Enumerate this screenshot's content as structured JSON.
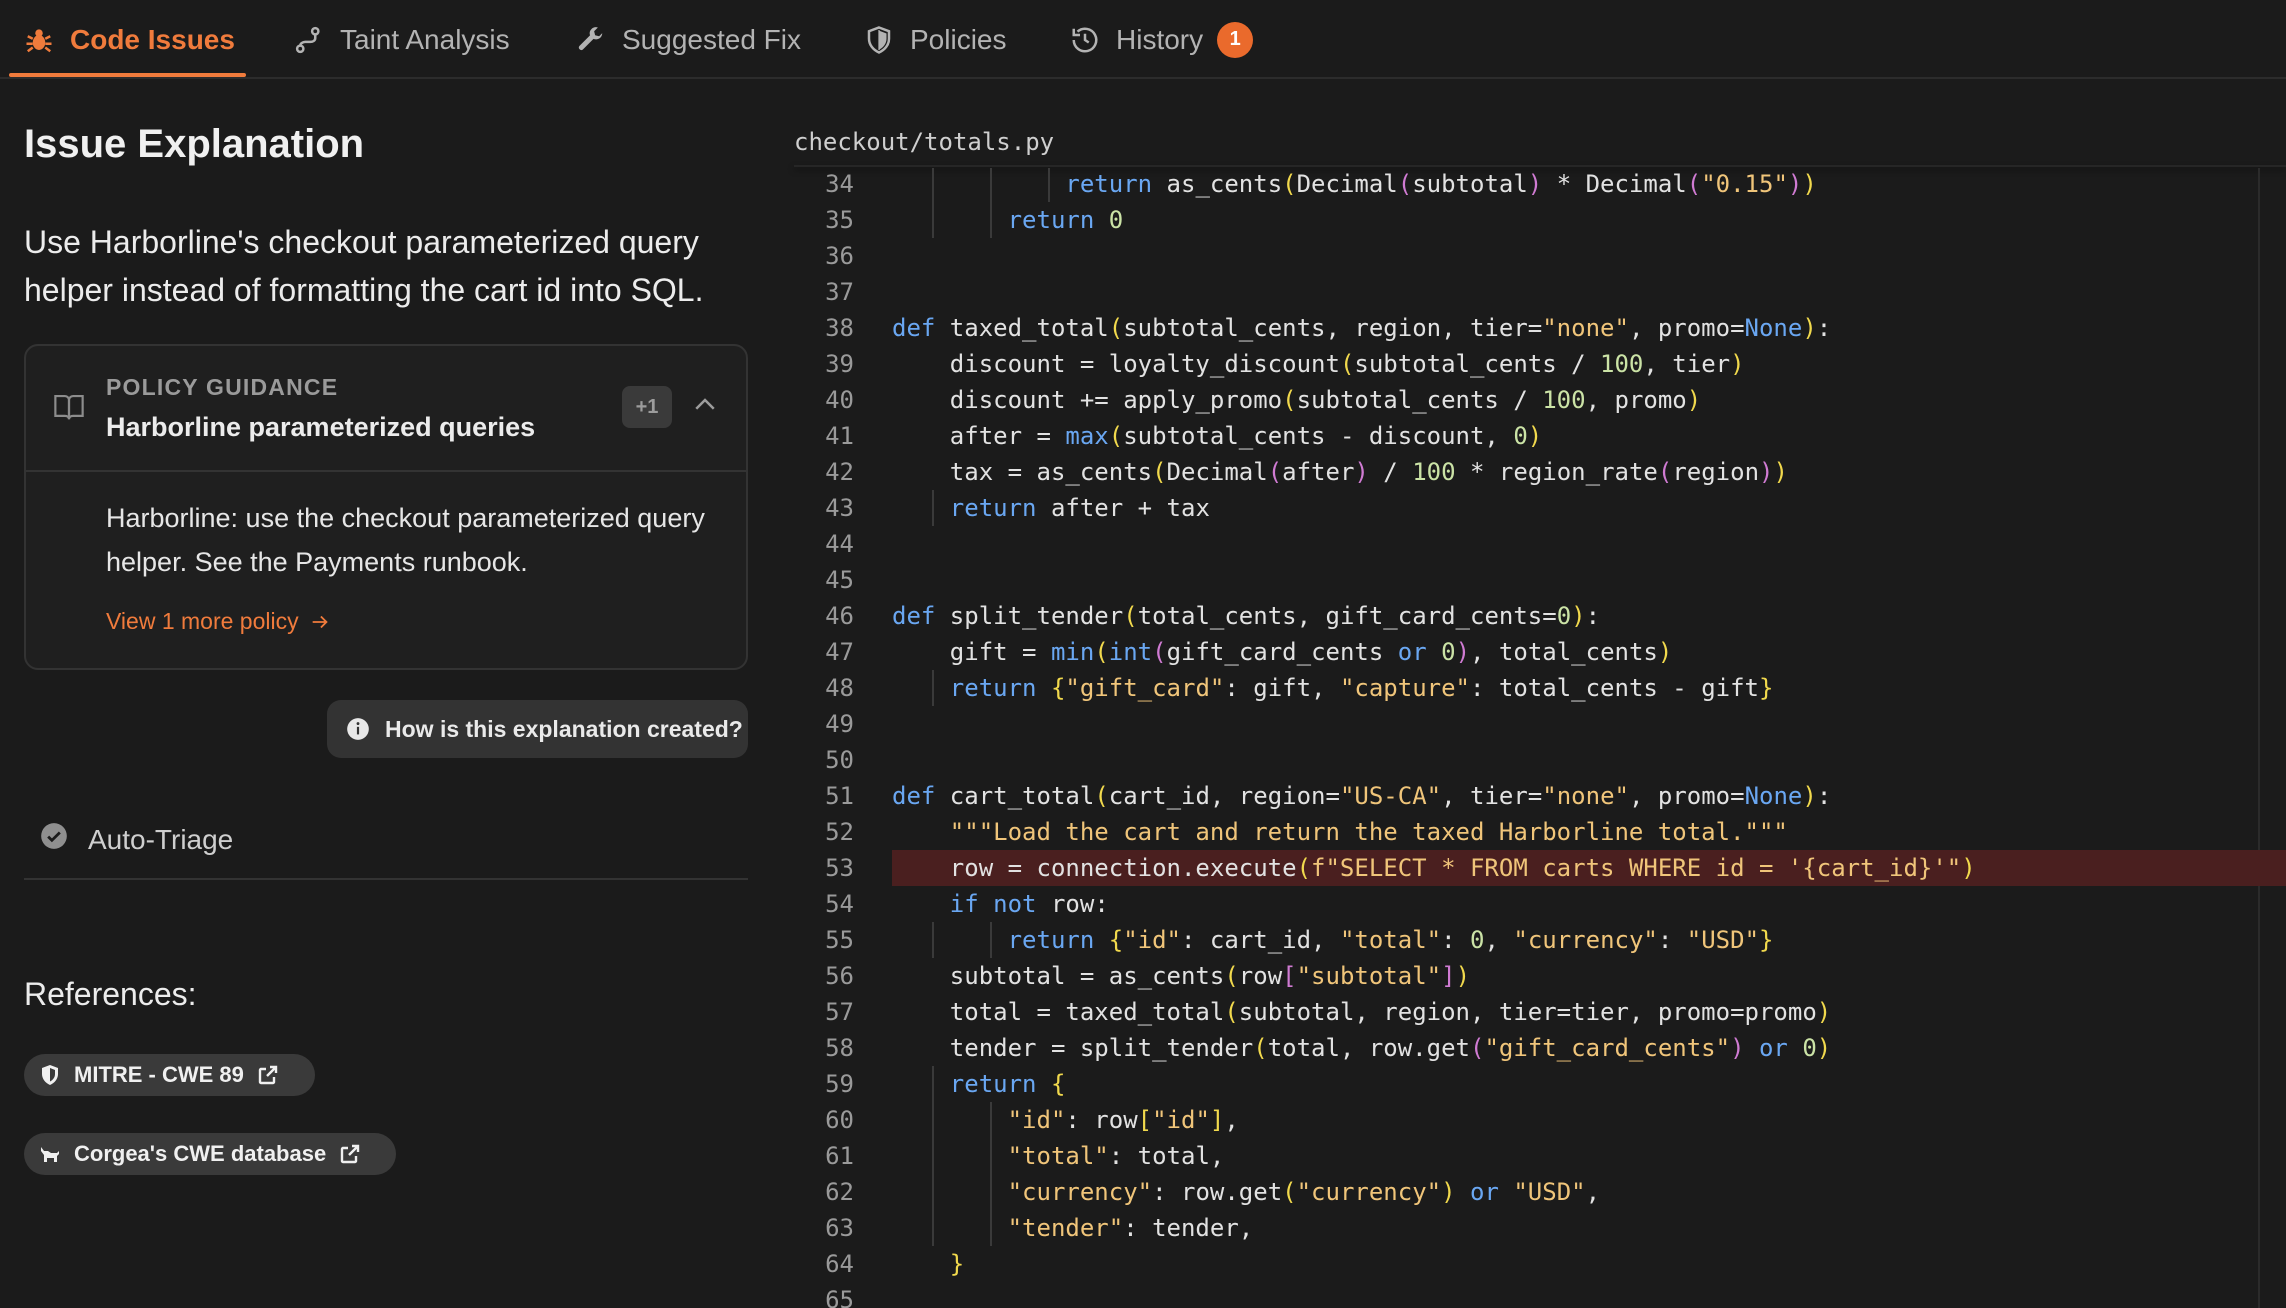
{
  "tabs": [
    {
      "label": "Code Issues",
      "icon": "bug-icon",
      "active": true
    },
    {
      "label": "Taint Analysis",
      "icon": "taint-flow-icon"
    },
    {
      "label": "Suggested Fix",
      "icon": "wrench-icon"
    },
    {
      "label": "Policies",
      "icon": "shield-icon"
    },
    {
      "label": "History",
      "icon": "history-icon",
      "badge": "1"
    }
  ],
  "panel": {
    "title": "Issue Explanation",
    "description": "Use Harborline's checkout parameterized query helper instead of formatting the cart id into SQL.",
    "policy": {
      "label": "POLICY GUIDANCE",
      "name": "Harborline parameterized queries",
      "extra_count": "+1",
      "body": "Harborline: use the checkout parameterized query helper. See the Payments runbook.",
      "link": "View 1 more policy"
    },
    "explain_button": "How is this explanation created?",
    "auto_triage": "Auto-Triage",
    "references_title": "References:",
    "references": [
      "MITRE - CWE 89",
      "Corgea's CWE database"
    ]
  },
  "code": {
    "filename": "checkout/totals.py",
    "highlight_line": 53,
    "lines": [
      {
        "n": "34",
        "t": "            return as_cents(Decimal(subtotal) * Decimal(\"0.15\"))"
      },
      {
        "n": "35",
        "t": "        return 0"
      },
      {
        "n": "36",
        "t": ""
      },
      {
        "n": "37",
        "t": ""
      },
      {
        "n": "38",
        "t": "def taxed_total(subtotal_cents, region, tier=\"none\", promo=None):"
      },
      {
        "n": "39",
        "t": "    discount = loyalty_discount(subtotal_cents / 100, tier)"
      },
      {
        "n": "40",
        "t": "    discount += apply_promo(subtotal_cents / 100, promo)"
      },
      {
        "n": "41",
        "t": "    after = max(subtotal_cents - discount, 0)"
      },
      {
        "n": "42",
        "t": "    tax = as_cents(Decimal(after) / 100 * region_rate(region))"
      },
      {
        "n": "43",
        "t": "    return after + tax"
      },
      {
        "n": "44",
        "t": ""
      },
      {
        "n": "45",
        "t": ""
      },
      {
        "n": "46",
        "t": "def split_tender(total_cents, gift_card_cents=0):"
      },
      {
        "n": "47",
        "t": "    gift = min(int(gift_card_cents or 0), total_cents)"
      },
      {
        "n": "48",
        "t": "    return {\"gift_card\": gift, \"capture\": total_cents - gift}"
      },
      {
        "n": "49",
        "t": ""
      },
      {
        "n": "50",
        "t": ""
      },
      {
        "n": "51",
        "t": "def cart_total(cart_id, region=\"US-CA\", tier=\"none\", promo=None):"
      },
      {
        "n": "52",
        "t": "    \"\"\"Load the cart and return the taxed Harborline total.\"\"\""
      },
      {
        "n": "53",
        "t": "    row = connection.execute(f\"SELECT * FROM carts WHERE id = '{cart_id}'\")"
      },
      {
        "n": "54",
        "t": "    if not row:"
      },
      {
        "n": "55",
        "t": "        return {\"id\": cart_id, \"total\": 0, \"currency\": \"USD\"}"
      },
      {
        "n": "56",
        "t": "    subtotal = as_cents(row[\"subtotal\"])"
      },
      {
        "n": "57",
        "t": "    total = taxed_total(subtotal, region, tier=tier, promo=promo)"
      },
      {
        "n": "58",
        "t": "    tender = split_tender(total, row.get(\"gift_card_cents\") or 0)"
      },
      {
        "n": "59",
        "t": "    return {"
      },
      {
        "n": "60",
        "t": "        \"id\": row[\"id\"],"
      },
      {
        "n": "61",
        "t": "        \"total\": total,"
      },
      {
        "n": "62",
        "t": "        \"currency\": row.get(\"currency\") or \"USD\","
      },
      {
        "n": "63",
        "t": "        \"tender\": tender,"
      },
      {
        "n": "64",
        "t": "    }"
      },
      {
        "n": "65",
        "t": ""
      }
    ]
  },
  "colors": {
    "accent": "#f07b3c",
    "keyword": "#6aa7f2",
    "string": "#f0c57a",
    "highlight": "#4a1f1f"
  }
}
